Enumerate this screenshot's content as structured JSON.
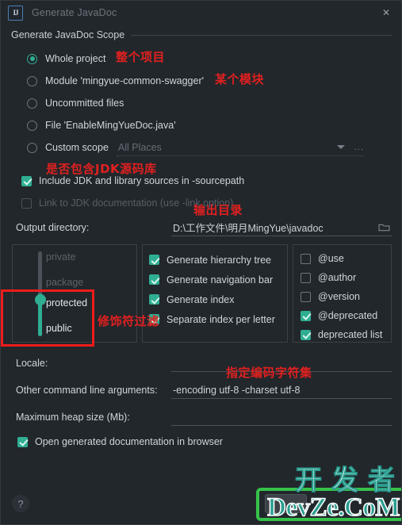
{
  "window": {
    "title": "Generate JavaDoc",
    "app_icon": "intellij-idea-icon",
    "icon_text": "IJ",
    "close_icon": "close-icon",
    "close_glyph": "✕"
  },
  "scope_section": {
    "header": "Generate JavaDoc Scope",
    "options": [
      {
        "label": "Whole project",
        "mnemonic": "j",
        "selected": true,
        "annotation": "整个项目"
      },
      {
        "label": "Module 'mingyue-common-swagger'",
        "mnemonic": "M",
        "selected": false,
        "annotation": "某个模块"
      },
      {
        "label": "Uncommitted files",
        "mnemonic": "U",
        "selected": false,
        "annotation": ""
      },
      {
        "label": "File 'EnableMingYueDoc.java'",
        "mnemonic": "F",
        "selected": false,
        "annotation": ""
      },
      {
        "label": "Custom scope",
        "mnemonic": "C",
        "selected": false,
        "annotation": ""
      }
    ],
    "custom_scope": {
      "value": "All Places",
      "dropdown_icon": "chevron-down-icon",
      "browse_label": "..."
    }
  },
  "jdk_options": {
    "include_sources": {
      "label": "Include JDK and library sources in -sourcepath",
      "checked": true,
      "enabled": true,
      "annotation": "是否包含JDK源码库"
    },
    "link_docs": {
      "label": "Link to JDK documentation (use -link option)",
      "checked": false,
      "enabled": false
    }
  },
  "output": {
    "label": "Output directory:",
    "mnemonic": "d",
    "value": "D:\\工作文件\\明月MingYue\\javadoc",
    "browse_icon": "folder-icon",
    "annotation": "输出目录"
  },
  "visibility": {
    "levels": [
      "private",
      "package",
      "protected",
      "public"
    ],
    "selected": "protected",
    "annotation": "修饰符过滤"
  },
  "generate_options": [
    {
      "label": "Generate hierarchy tree",
      "checked": true
    },
    {
      "label": "Generate navigation bar",
      "checked": true
    },
    {
      "label": "Generate index",
      "checked": true
    },
    {
      "label": "Separate index per letter",
      "checked": true
    }
  ],
  "tag_options": [
    {
      "label": "@use",
      "checked": false
    },
    {
      "label": "@author",
      "checked": false
    },
    {
      "label": "@version",
      "checked": false
    },
    {
      "label": "@deprecated",
      "checked": true
    },
    {
      "label": "deprecated list",
      "checked": true
    }
  ],
  "bottom_fields": [
    {
      "label": "Locale:",
      "mnemonic": "L",
      "value": ""
    },
    {
      "label": "Other command line arguments:",
      "mnemonic": "O",
      "value": "-encoding utf-8 -charset utf-8",
      "annotation": "指定编码字符集"
    },
    {
      "label": "Maximum heap size (Mb):",
      "mnemonic": "M",
      "value": ""
    }
  ],
  "open_in_browser": {
    "label": "Open generated documentation in browser",
    "checked": true
  },
  "footer": {
    "help_label": "?",
    "help_icon": "help-icon"
  },
  "watermark": {
    "chinese": "开发者",
    "english": "DevZe.CoM"
  },
  "colors": {
    "accent": "#2fae92",
    "annotation_red": "#e02020",
    "highlight_red": "#ee1c1c",
    "highlight_green": "#35c24a",
    "background": "#22272b",
    "text": "#cfd5db",
    "text_dim": "#5b636b"
  }
}
